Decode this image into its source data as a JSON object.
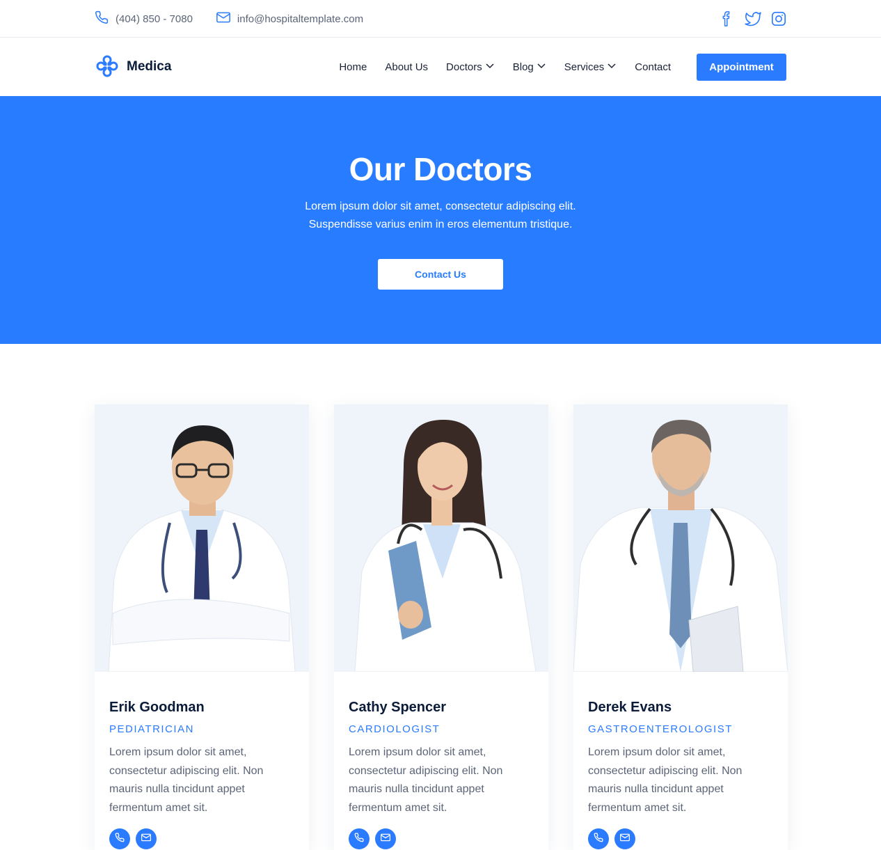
{
  "topbar": {
    "phone": "(404) 850 - 7080",
    "email": "info@hospitaltemplate.com",
    "socials": [
      "facebook-icon",
      "twitter-icon",
      "instagram-icon"
    ]
  },
  "nav": {
    "brand": "Medica",
    "items": [
      {
        "label": "Home",
        "dropdown": false
      },
      {
        "label": "About Us",
        "dropdown": false
      },
      {
        "label": "Doctors",
        "dropdown": true
      },
      {
        "label": "Blog",
        "dropdown": true
      },
      {
        "label": "Services",
        "dropdown": true
      },
      {
        "label": "Contact",
        "dropdown": false
      }
    ],
    "cta": "Appointment"
  },
  "hero": {
    "title": "Our Doctors",
    "subtitle_line1": "Lorem ipsum dolor sit amet, consectetur adipiscing elit.",
    "subtitle_line2": "Suspendisse varius enim in eros elementum tristique.",
    "button": "Contact Us"
  },
  "doctors": [
    {
      "name": "Erik Goodman",
      "role": "PEDIATRICIAN",
      "desc": "Lorem ipsum dolor sit amet, consectetur adipiscing elit. Non mauris nulla tincidunt  appet fermentum amet sit."
    },
    {
      "name": "Cathy Spencer",
      "role": "CARDIOLOGIST",
      "desc": "Lorem ipsum dolor sit amet, consectetur adipiscing elit. Non mauris nulla tincidunt  appet fermentum amet sit."
    },
    {
      "name": "Derek Evans",
      "role": "GASTROENTEROLOGIST",
      "desc": "Lorem ipsum dolor sit amet, consectetur adipiscing elit. Non mauris nulla tincidunt  appet fermentum amet sit."
    }
  ],
  "colors": {
    "accent": "#2a7bff",
    "hero_bg": "#287cff",
    "photo_bg": "#eff4fb",
    "text_dark": "#0b1b3a",
    "text_muted": "#5c6478"
  }
}
